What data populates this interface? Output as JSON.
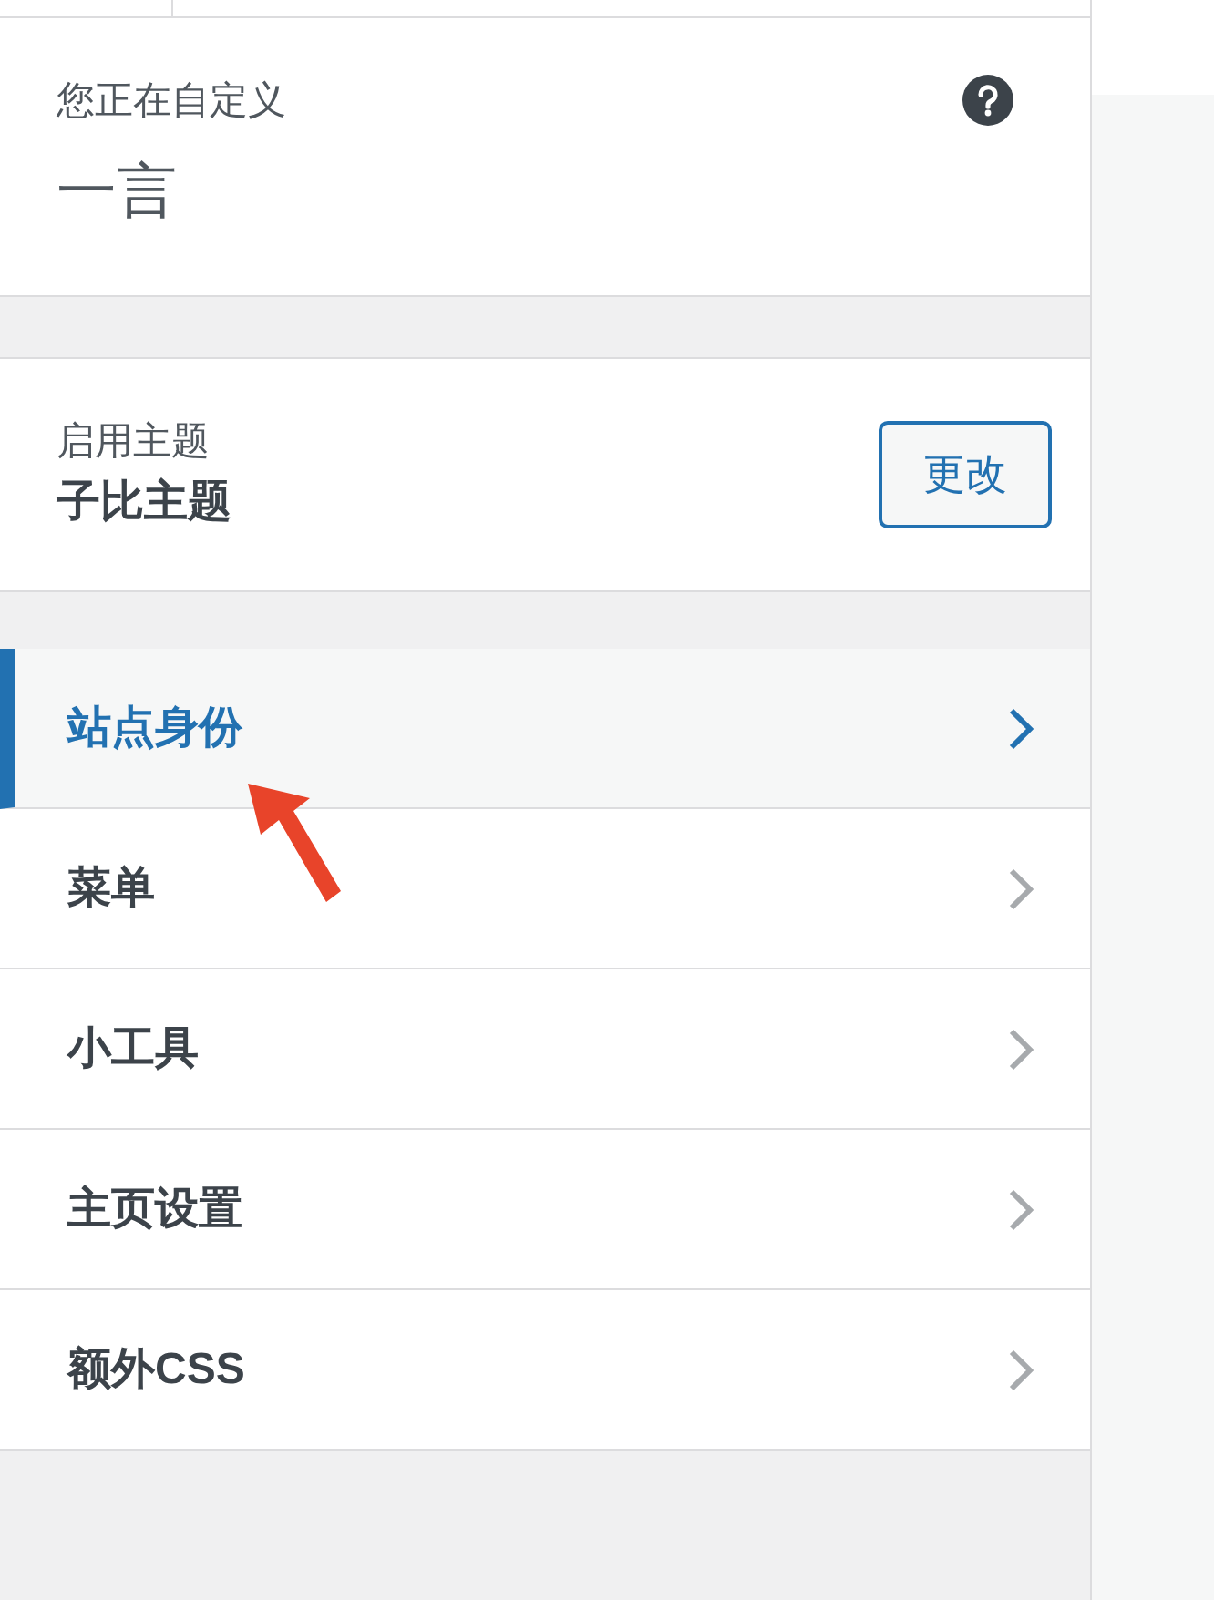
{
  "customizing": {
    "label": "您正在自定义",
    "title": "一言"
  },
  "theme": {
    "label": "启用主题",
    "name": "子比主题",
    "button": "更改"
  },
  "sections": [
    {
      "label": "站点身份",
      "selected": true
    },
    {
      "label": "菜单",
      "selected": false
    },
    {
      "label": "小工具",
      "selected": false
    },
    {
      "label": "主页设置",
      "selected": false
    },
    {
      "label": "额外CSS",
      "selected": false
    }
  ],
  "annotation": {
    "kind": "arrow"
  }
}
